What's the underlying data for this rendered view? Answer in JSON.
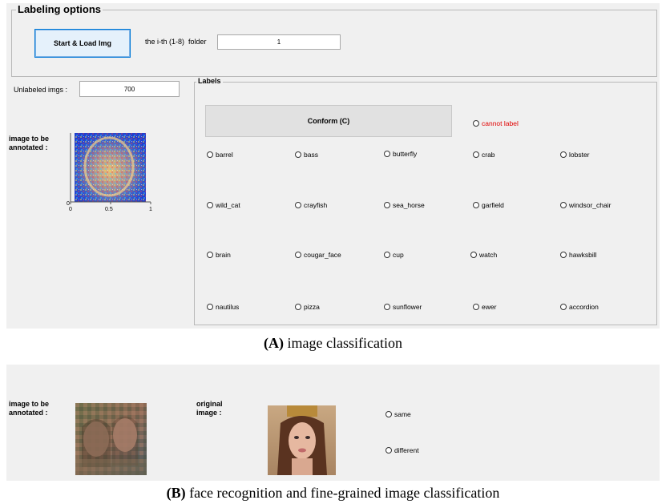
{
  "panel_a": {
    "labeling_options": {
      "title": "Labeling options",
      "start_button": "Start & Load Img",
      "folder_label": "the i-th (1-8)  folder",
      "folder_value": "1"
    },
    "unlabeled_label": "Unlabeled imgs :",
    "unlabeled_value": "700",
    "image_label_line1": "image to be",
    "image_label_line2": "annotated :",
    "axis": {
      "x_ticks": [
        "0",
        "0.5",
        "1"
      ],
      "y_ticks": [
        "0"
      ]
    },
    "labels_group": {
      "title": "Labels",
      "conform_button": "Conform (C)",
      "cannot_label": "cannot label",
      "options": [
        [
          "barrel",
          "bass",
          "butterfly",
          "crab",
          "lobster"
        ],
        [
          "wild_cat",
          "crayfish",
          "sea_horse",
          "garfield",
          "windsor_chair"
        ],
        [
          "brain",
          "cougar_face",
          "cup",
          "watch",
          "hawksbill"
        ],
        [
          "nautilus",
          "pizza",
          "sunflower",
          "ewer",
          "accordion"
        ]
      ]
    },
    "caption_bold": "(A)",
    "caption_text": " image classification"
  },
  "panel_b": {
    "image_label_line1": "image to be",
    "image_label_line2": "annotated :",
    "original_label_line1": "original",
    "original_label_line2": "image :",
    "option_same": "same",
    "option_different": "different",
    "caption_bold": "(B)",
    "caption_text": " face recognition and fine-grained image classification"
  },
  "colors": {
    "panel_bg": "#f0f0f0",
    "cannot_label": "#e00000",
    "start_button_border": "#0078d7"
  }
}
